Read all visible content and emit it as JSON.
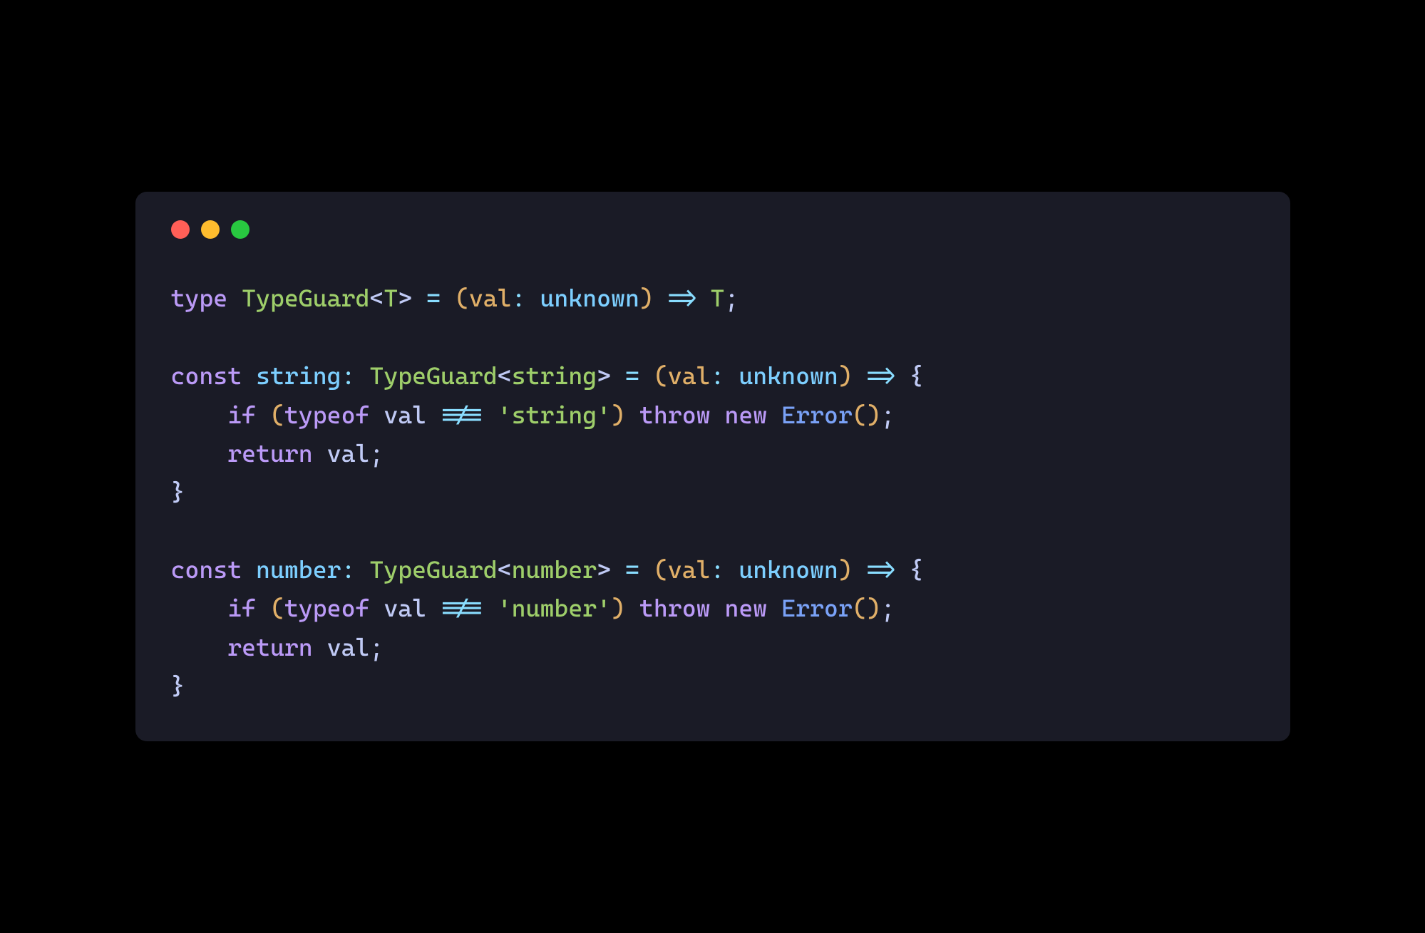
{
  "window": {
    "controls": {
      "red": "close",
      "yellow": "minimize",
      "green": "maximize"
    }
  },
  "code": {
    "tokens": [
      [
        {
          "t": "type ",
          "c": "tk-keyword"
        },
        {
          "t": "TypeGuard",
          "c": "tk-type"
        },
        {
          "t": "<",
          "c": "tk-punct"
        },
        {
          "t": "T",
          "c": "tk-typeparam"
        },
        {
          "t": ">",
          "c": "tk-punct"
        },
        {
          "t": " = ",
          "c": "tk-operator"
        },
        {
          "t": "(",
          "c": "tk-paren"
        },
        {
          "t": "val",
          "c": "tk-param"
        },
        {
          "t": ":",
          "c": "tk-operator"
        },
        {
          "t": " ",
          "c": "tk-plain"
        },
        {
          "t": "unknown",
          "c": "tk-unknown"
        },
        {
          "t": ")",
          "c": "tk-paren"
        },
        {
          "t": " => ",
          "c": "tk-operator"
        },
        {
          "t": "T",
          "c": "tk-typeparam"
        },
        {
          "t": ";",
          "c": "tk-punct"
        }
      ],
      [],
      [
        {
          "t": "const ",
          "c": "tk-keyword"
        },
        {
          "t": "string",
          "c": "tk-identifier"
        },
        {
          "t": ":",
          "c": "tk-operator"
        },
        {
          "t": " ",
          "c": "tk-plain"
        },
        {
          "t": "TypeGuard",
          "c": "tk-type"
        },
        {
          "t": "<",
          "c": "tk-punct"
        },
        {
          "t": "string",
          "c": "tk-type"
        },
        {
          "t": ">",
          "c": "tk-punct"
        },
        {
          "t": " = ",
          "c": "tk-operator"
        },
        {
          "t": "(",
          "c": "tk-paren"
        },
        {
          "t": "val",
          "c": "tk-param"
        },
        {
          "t": ":",
          "c": "tk-operator"
        },
        {
          "t": " ",
          "c": "tk-plain"
        },
        {
          "t": "unknown",
          "c": "tk-unknown"
        },
        {
          "t": ")",
          "c": "tk-paren"
        },
        {
          "t": " => ",
          "c": "tk-operator"
        },
        {
          "t": "{",
          "c": "tk-punct"
        }
      ],
      [
        {
          "t": "    ",
          "c": "tk-plain"
        },
        {
          "t": "if ",
          "c": "tk-keyword"
        },
        {
          "t": "(",
          "c": "tk-paren"
        },
        {
          "t": "typeof ",
          "c": "tk-keyword"
        },
        {
          "t": "val",
          "c": "tk-plain"
        },
        {
          "t": " !== ",
          "c": "tk-operator"
        },
        {
          "t": "'string'",
          "c": "tk-string"
        },
        {
          "t": ")",
          "c": "tk-paren"
        },
        {
          "t": " ",
          "c": "tk-plain"
        },
        {
          "t": "throw ",
          "c": "tk-keyword"
        },
        {
          "t": "new ",
          "c": "tk-keyword"
        },
        {
          "t": "Error",
          "c": "tk-func"
        },
        {
          "t": "(",
          "c": "tk-paren"
        },
        {
          "t": ")",
          "c": "tk-paren"
        },
        {
          "t": ";",
          "c": "tk-punct"
        }
      ],
      [
        {
          "t": "    ",
          "c": "tk-plain"
        },
        {
          "t": "return ",
          "c": "tk-keyword"
        },
        {
          "t": "val",
          "c": "tk-plain"
        },
        {
          "t": ";",
          "c": "tk-punct"
        }
      ],
      [
        {
          "t": "}",
          "c": "tk-punct"
        }
      ],
      [],
      [
        {
          "t": "const ",
          "c": "tk-keyword"
        },
        {
          "t": "number",
          "c": "tk-identifier"
        },
        {
          "t": ":",
          "c": "tk-operator"
        },
        {
          "t": " ",
          "c": "tk-plain"
        },
        {
          "t": "TypeGuard",
          "c": "tk-type"
        },
        {
          "t": "<",
          "c": "tk-punct"
        },
        {
          "t": "number",
          "c": "tk-type"
        },
        {
          "t": ">",
          "c": "tk-punct"
        },
        {
          "t": " = ",
          "c": "tk-operator"
        },
        {
          "t": "(",
          "c": "tk-paren"
        },
        {
          "t": "val",
          "c": "tk-param"
        },
        {
          "t": ":",
          "c": "tk-operator"
        },
        {
          "t": " ",
          "c": "tk-plain"
        },
        {
          "t": "unknown",
          "c": "tk-unknown"
        },
        {
          "t": ")",
          "c": "tk-paren"
        },
        {
          "t": " => ",
          "c": "tk-operator"
        },
        {
          "t": "{",
          "c": "tk-punct"
        }
      ],
      [
        {
          "t": "    ",
          "c": "tk-plain"
        },
        {
          "t": "if ",
          "c": "tk-keyword"
        },
        {
          "t": "(",
          "c": "tk-paren"
        },
        {
          "t": "typeof ",
          "c": "tk-keyword"
        },
        {
          "t": "val",
          "c": "tk-plain"
        },
        {
          "t": " !== ",
          "c": "tk-operator"
        },
        {
          "t": "'number'",
          "c": "tk-string"
        },
        {
          "t": ")",
          "c": "tk-paren"
        },
        {
          "t": " ",
          "c": "tk-plain"
        },
        {
          "t": "throw ",
          "c": "tk-keyword"
        },
        {
          "t": "new ",
          "c": "tk-keyword"
        },
        {
          "t": "Error",
          "c": "tk-func"
        },
        {
          "t": "(",
          "c": "tk-paren"
        },
        {
          "t": ")",
          "c": "tk-paren"
        },
        {
          "t": ";",
          "c": "tk-punct"
        }
      ],
      [
        {
          "t": "    ",
          "c": "tk-plain"
        },
        {
          "t": "return ",
          "c": "tk-keyword"
        },
        {
          "t": "val",
          "c": "tk-plain"
        },
        {
          "t": ";",
          "c": "tk-punct"
        }
      ],
      [
        {
          "t": "}",
          "c": "tk-punct"
        }
      ]
    ]
  }
}
